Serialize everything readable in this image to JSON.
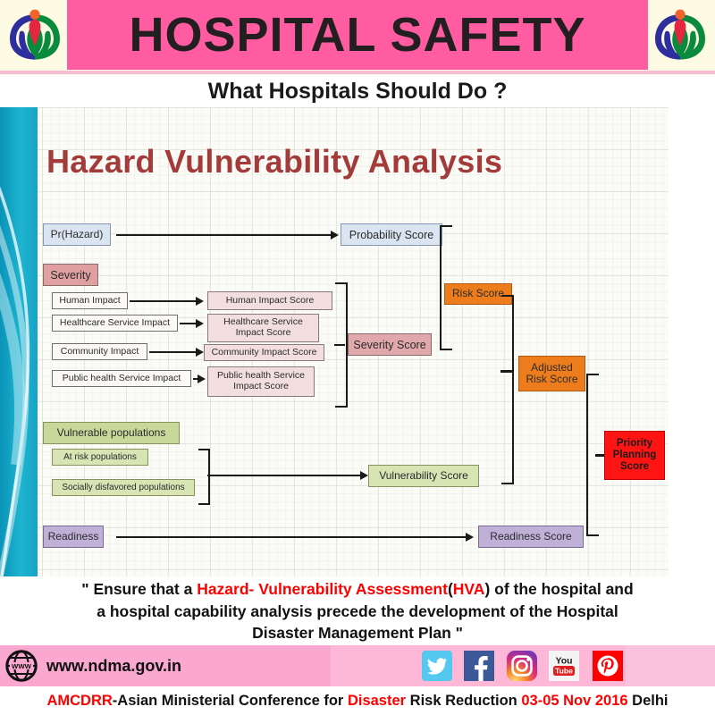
{
  "header": {
    "title": "HOSPITAL SAFETY",
    "subtitle": "What Hospitals Should Do ?",
    "logo_left": "ndma-logo-icon",
    "logo_right": "ndma-logo-icon",
    "pink": "#ff5ca2",
    "cream": "#fdfbe4"
  },
  "slide": {
    "title": "Hazard Vulnerability Analysis",
    "title_color": "#a33b3b",
    "side_band_color": "#18a5c6"
  },
  "diagram": {
    "inputs": [
      {
        "label": "Pr(Hazard)",
        "color": "#dbe5f1"
      },
      {
        "label": "Severity",
        "color": "#e0a0a2"
      },
      {
        "label": "Vulnerable populations",
        "color": "#c8d79a"
      },
      {
        "label": "Readiness",
        "color": "#c0b0d8"
      }
    ],
    "severity_factors": [
      "Human Impact",
      "Healthcare Service Impact",
      "Community Impact",
      "Public health Service Impact"
    ],
    "severity_factor_scores": [
      "Human Impact Score",
      "Healthcare Service Impact Score",
      "Community Impact  Score",
      "Public health Service Impact Score"
    ],
    "vulnerability_factors": [
      "At risk populations",
      "Socially disfavored populations"
    ],
    "scores": [
      {
        "label": "Probability Score",
        "color": "#dbe5f1"
      },
      {
        "label": "Severity Score",
        "color": "#e0a8aa"
      },
      {
        "label": "Vulnerability Score",
        "color": "#d7e4b4"
      },
      {
        "label": "Readiness Score",
        "color": "#c0b0d8"
      }
    ],
    "aggregates": [
      {
        "label": "Risk Score",
        "color": "#ed7d1c"
      },
      {
        "label": "Adjusted Risk Score",
        "color": "#ed7d1c"
      },
      {
        "label": "Priority Planning Score",
        "color": "#ff1414"
      }
    ],
    "healthcare_score_line1": "Healthcare Service",
    "healthcare_score_line2": "Impact Score",
    "publichealth_score_line1": "Public health Service",
    "publichealth_score_line2": "Impact Score",
    "adjusted_line1": "Adjusted",
    "adjusted_line2": "Risk Score",
    "priority_line1": "Priority",
    "priority_line2": "Planning",
    "priority_line3": "Score"
  },
  "quote": {
    "line1_a": "\" Ensure that a ",
    "line1_hazard": "Hazard",
    "line1_b": "- ",
    "line1_vuln": "Vulnerability Assessment",
    "line1_c": "(",
    "line1_hva": "HVA",
    "line1_d": ") of the hospital and",
    "line2": "a hospital capability analysis precede the development of the Hospital",
    "line3": "Disaster Management Plan \""
  },
  "footer": {
    "globe_icon": "www-globe-icon",
    "url": "www.ndma.gov.in",
    "social": [
      {
        "name": "twitter-icon",
        "color": "#55c8f0"
      },
      {
        "name": "facebook-icon",
        "color": "#3b5998"
      },
      {
        "name": "instagram-icon",
        "color": "#e1306c"
      },
      {
        "name": "youtube-icon",
        "color": "#ff0000"
      },
      {
        "name": "pinterest-icon",
        "color": "#ff0000"
      }
    ],
    "band_amcdrr": "AMCDRR",
    "band_mid1": "-Asian Ministerial Conference for ",
    "band_disaster": "Disaster",
    "band_mid2": " Risk Reduction  ",
    "band_dates": "03-05 Nov 2016",
    "band_place": " Delhi"
  }
}
